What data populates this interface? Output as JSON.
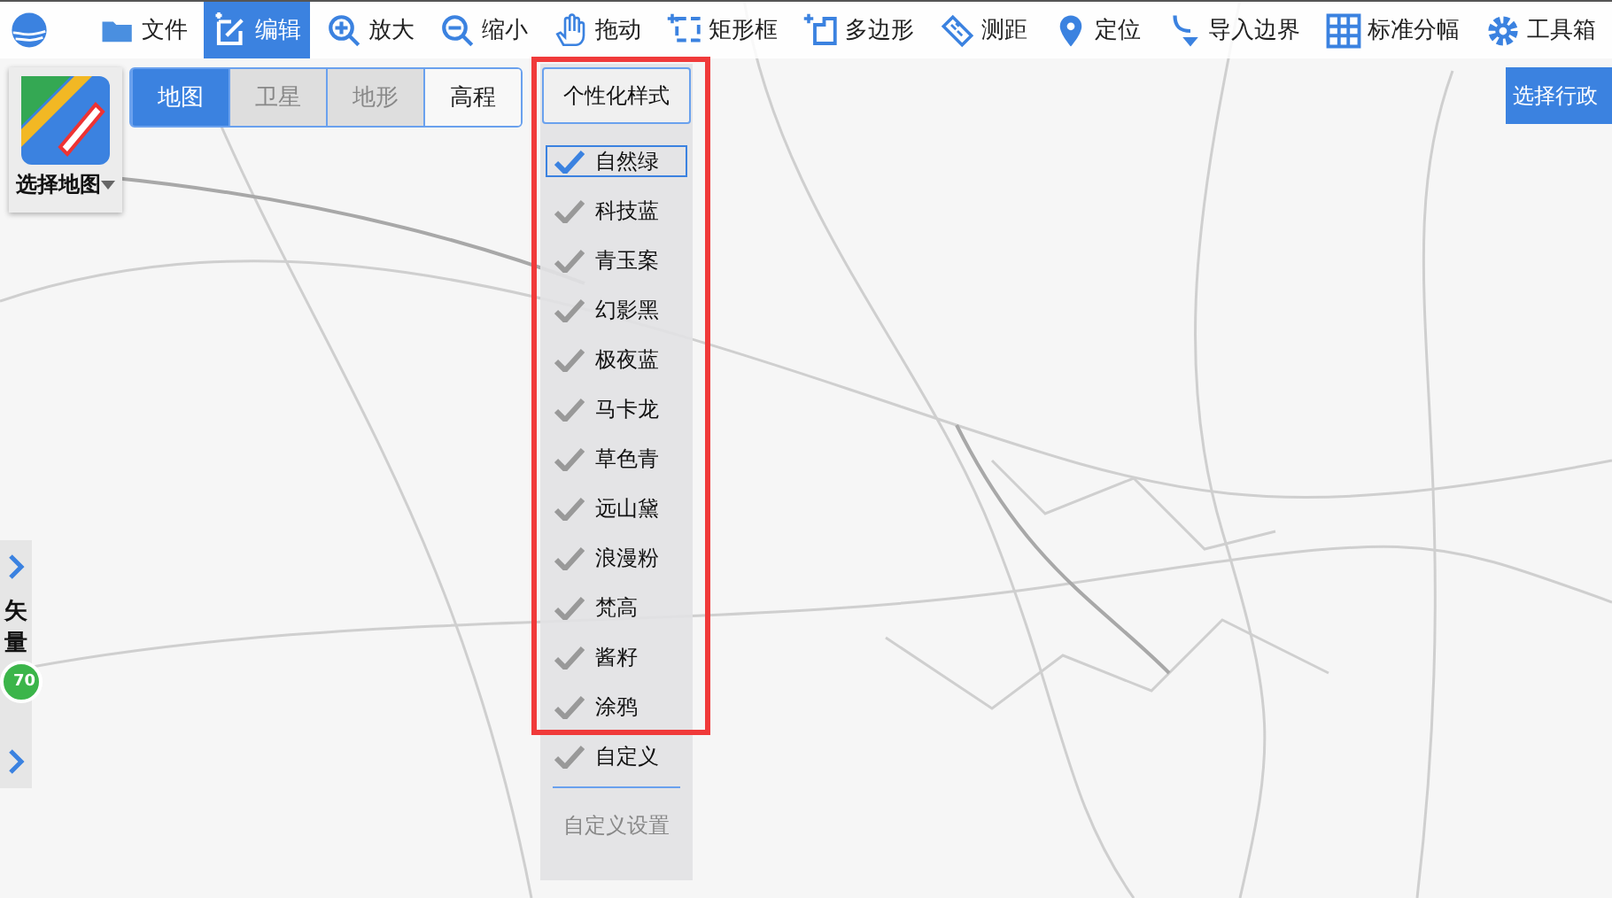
{
  "toolbar": {
    "items": [
      {
        "kind": "file",
        "label": "文件",
        "selected": false
      },
      {
        "kind": "edit",
        "label": "编辑",
        "selected": true
      },
      {
        "kind": "zoom-in",
        "label": "放大",
        "selected": false
      },
      {
        "kind": "zoom-out",
        "label": "缩小",
        "selected": false
      },
      {
        "kind": "hand",
        "label": "拖动",
        "selected": false
      },
      {
        "kind": "rect",
        "label": "矩形框",
        "selected": false
      },
      {
        "kind": "polygon",
        "label": "多边形",
        "selected": false
      },
      {
        "kind": "ruler",
        "label": "测距",
        "selected": false
      },
      {
        "kind": "pin",
        "label": "定位",
        "selected": false
      },
      {
        "kind": "import",
        "label": "导入边界",
        "selected": false
      },
      {
        "kind": "grid",
        "label": "标准分幅",
        "selected": false
      },
      {
        "kind": "gear",
        "label": "工具箱",
        "selected": false
      }
    ]
  },
  "map_chooser": {
    "label": "选择地图"
  },
  "map_types": [
    {
      "label": "地图",
      "selected": true,
      "disabled": false
    },
    {
      "label": "卫星",
      "selected": false,
      "disabled": true
    },
    {
      "label": "地形",
      "selected": false,
      "disabled": true
    },
    {
      "label": "高程",
      "selected": false,
      "disabled": false
    }
  ],
  "style_menu": {
    "button": "个性化样式",
    "items": [
      {
        "label": "自然绿",
        "selected": true
      },
      {
        "label": "科技蓝",
        "selected": false
      },
      {
        "label": "青玉案",
        "selected": false
      },
      {
        "label": "幻影黑",
        "selected": false
      },
      {
        "label": "极夜蓝",
        "selected": false
      },
      {
        "label": "马卡龙",
        "selected": false
      },
      {
        "label": "草色青",
        "selected": false
      },
      {
        "label": "远山黛",
        "selected": false
      },
      {
        "label": "浪漫粉",
        "selected": false
      },
      {
        "label": "梵高",
        "selected": false
      },
      {
        "label": "酱籽",
        "selected": false
      },
      {
        "label": "涂鸦",
        "selected": false
      },
      {
        "label": "自定义",
        "selected": false
      }
    ],
    "settings": "自定义设置"
  },
  "region_button": "选择行政",
  "side_panel": {
    "label": "矢量",
    "badge": "70"
  }
}
